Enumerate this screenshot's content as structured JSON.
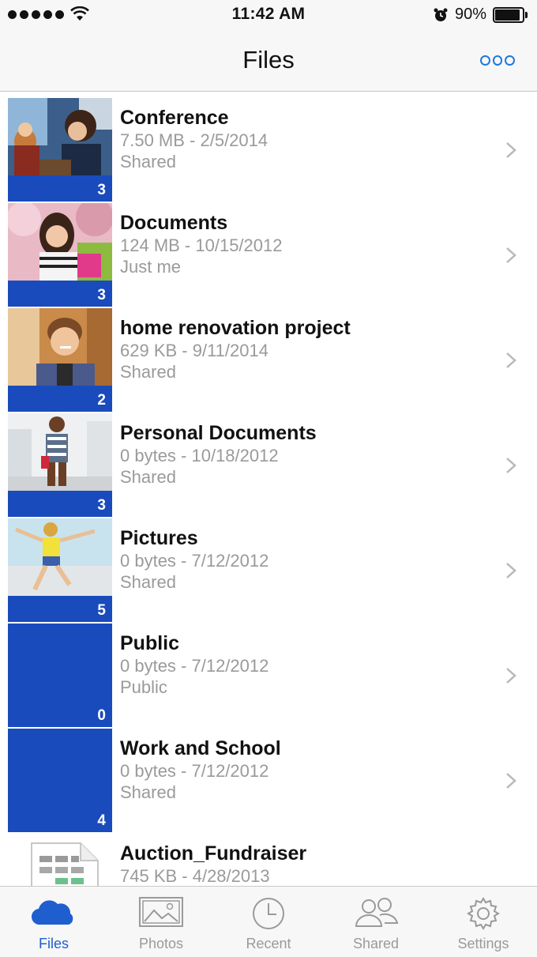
{
  "status_bar": {
    "time": "11:42 AM",
    "battery_percent": "90%",
    "battery_level": 0.9
  },
  "nav": {
    "title": "Files",
    "more_icon": "more-dots-icon"
  },
  "files": [
    {
      "name": "Conference",
      "meta": "7.50 MB - 2/5/2014",
      "sharing": "Shared",
      "count": "3",
      "thumb": "photo-people"
    },
    {
      "name": "Documents",
      "meta": "124 MB - 10/15/2012",
      "sharing": "Just me",
      "count": "3",
      "thumb": "photo-woman-blossoms"
    },
    {
      "name": "home renovation project",
      "meta": "629 KB - 9/11/2014",
      "sharing": "Shared",
      "count": "2",
      "thumb": "photo-man-smiling"
    },
    {
      "name": "Personal Documents",
      "meta": "0 bytes - 10/18/2012",
      "sharing": "Shared",
      "count": "3",
      "thumb": "photo-woman-walking"
    },
    {
      "name": "Pictures",
      "meta": "0 bytes - 7/12/2012",
      "sharing": "Shared",
      "count": "5",
      "thumb": "photo-woman-jumping"
    },
    {
      "name": "Public",
      "meta": "0 bytes - 7/12/2012",
      "sharing": "Public",
      "count": "0",
      "thumb": "empty-folder"
    },
    {
      "name": "Work and School",
      "meta": "0 bytes - 7/12/2012",
      "sharing": "Shared",
      "count": "4",
      "thumb": "empty-folder"
    },
    {
      "name": "Auction_Fundraiser",
      "meta": "745 KB - 4/28/2013",
      "sharing": "",
      "count": "",
      "thumb": "excel-file-icon"
    }
  ],
  "tabs": [
    {
      "label": "Files",
      "icon": "cloud-icon",
      "active": true
    },
    {
      "label": "Photos",
      "icon": "photos-icon",
      "active": false
    },
    {
      "label": "Recent",
      "icon": "clock-icon",
      "active": false
    },
    {
      "label": "Shared",
      "icon": "people-icon",
      "active": false
    },
    {
      "label": "Settings",
      "icon": "gear-icon",
      "active": false
    }
  ],
  "colors": {
    "accent": "#1f5ecf",
    "folder_blue": "#1a4bbd",
    "muted_text": "#9a9a9a"
  }
}
